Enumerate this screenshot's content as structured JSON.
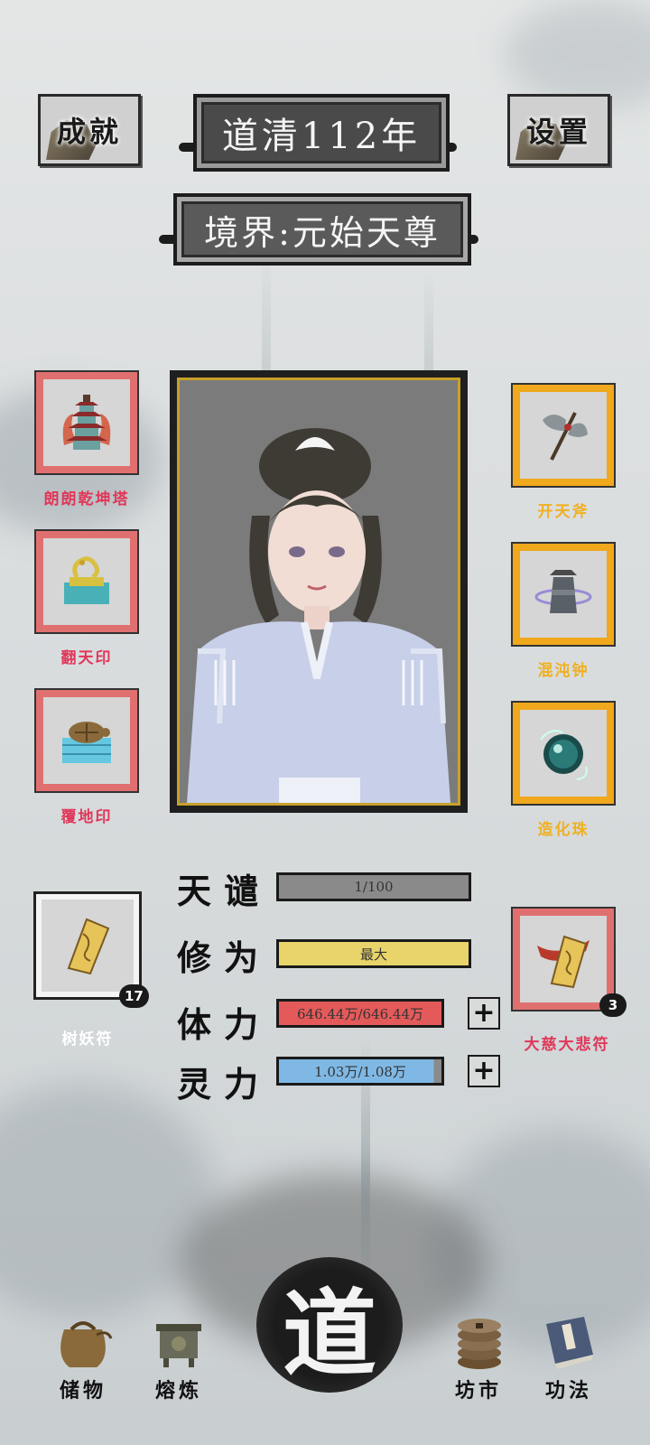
{
  "header": {
    "achievements_label": "成就",
    "settings_label": "设置",
    "year_label": "道清112年",
    "realm_label": "境界:元始天尊"
  },
  "left_slots": [
    {
      "name": "朗朗乾坤塔",
      "icon": "pagoda-icon",
      "rarity_color": "#e0385a"
    },
    {
      "name": "翻天印",
      "icon": "seal-dragon-icon",
      "rarity_color": "#e0385a"
    },
    {
      "name": "覆地印",
      "icon": "seal-turtle-icon",
      "rarity_color": "#e0385a"
    }
  ],
  "right_slots": [
    {
      "name": "开天斧",
      "icon": "axe-icon",
      "rarity_color": "#f0b020"
    },
    {
      "name": "混沌钟",
      "icon": "bell-icon",
      "rarity_color": "#f0b020"
    },
    {
      "name": "造化珠",
      "icon": "orb-icon",
      "rarity_color": "#f0b020"
    }
  ],
  "talismans": {
    "left": {
      "name": "树妖符",
      "count": "17",
      "label_color": "#ffffff"
    },
    "right": {
      "name": "大慈大悲符",
      "count": "3",
      "label_color": "#e0385a"
    }
  },
  "stats": [
    {
      "label": "天谴",
      "value": "1/100",
      "fill": 0.01,
      "color": "#8a8a8a"
    },
    {
      "label": "修为",
      "value": "最大",
      "fill": 1.0,
      "color": "#e8d46a"
    },
    {
      "label": "体力",
      "value": "646.44万/646.44万",
      "fill": 1.0,
      "color": "#e45a5a"
    },
    {
      "label": "灵力",
      "value": "1.03万/1.08万",
      "fill": 0.954,
      "color": "#7fb8e4"
    }
  ],
  "nav": {
    "storage_label": "储物",
    "smelt_label": "熔炼",
    "dao_label": "道",
    "market_label": "坊市",
    "skills_label": "功法"
  },
  "colors": {
    "red_rarity": "#e07070",
    "gold_rarity": "#f0a81c",
    "frame_gold": "#c8a02a"
  }
}
